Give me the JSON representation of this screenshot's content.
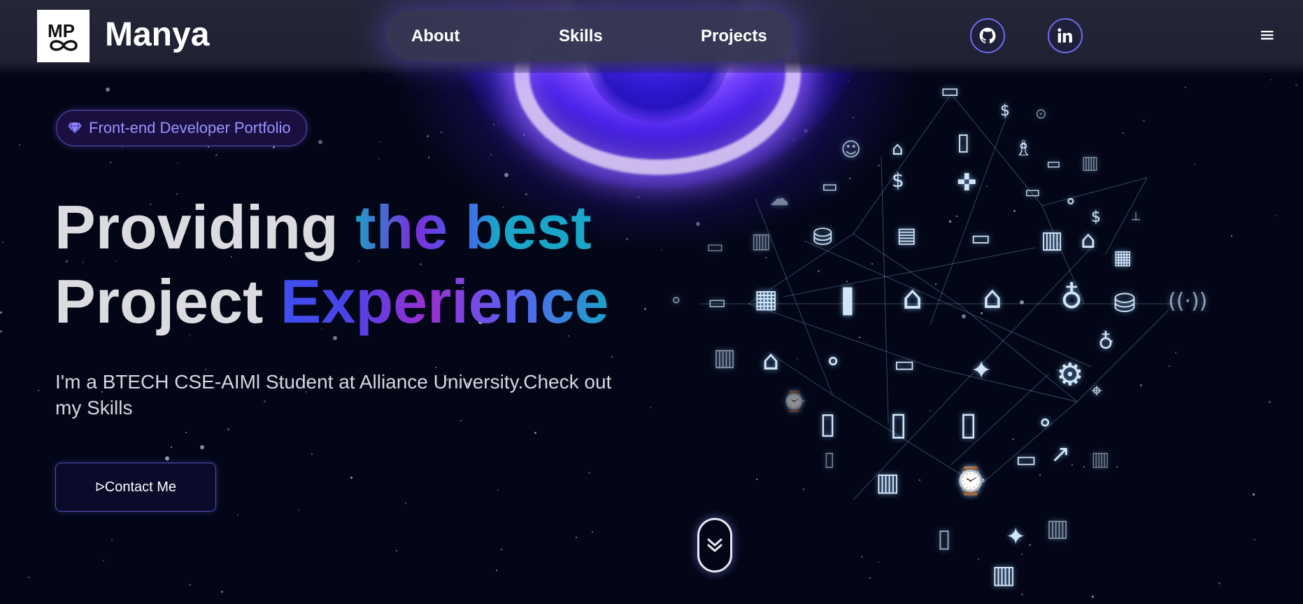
{
  "header": {
    "logo_text": "MP",
    "brand": "Manya",
    "nav": [
      {
        "label": "About"
      },
      {
        "label": "Skills"
      },
      {
        "label": "Projects"
      }
    ],
    "social": [
      {
        "icon": "github-icon"
      },
      {
        "icon": "linkedin-icon"
      }
    ],
    "menu_icon": "≡"
  },
  "hero": {
    "badge_label": "Front-end Developer Portfolio",
    "headline": {
      "line1_plain": "Providing ",
      "line1_gradient": "the best",
      "line2_plain": "Project ",
      "line2_gradient": "Experience"
    },
    "subtitle": "I'm a BTECH CSE-AIMl Student at Alliance University.Check out my Skills",
    "contact_icon": "ᐅ",
    "contact_label": "Contact Me"
  },
  "colors": {
    "background": "#030616",
    "accent": "#6f6cf0",
    "badge_text": "#9b93ff",
    "gradient_cyan": "#1aa6c8",
    "gradient_purple": "#9a2fd0",
    "gradient_blue": "#3f4ef0"
  }
}
